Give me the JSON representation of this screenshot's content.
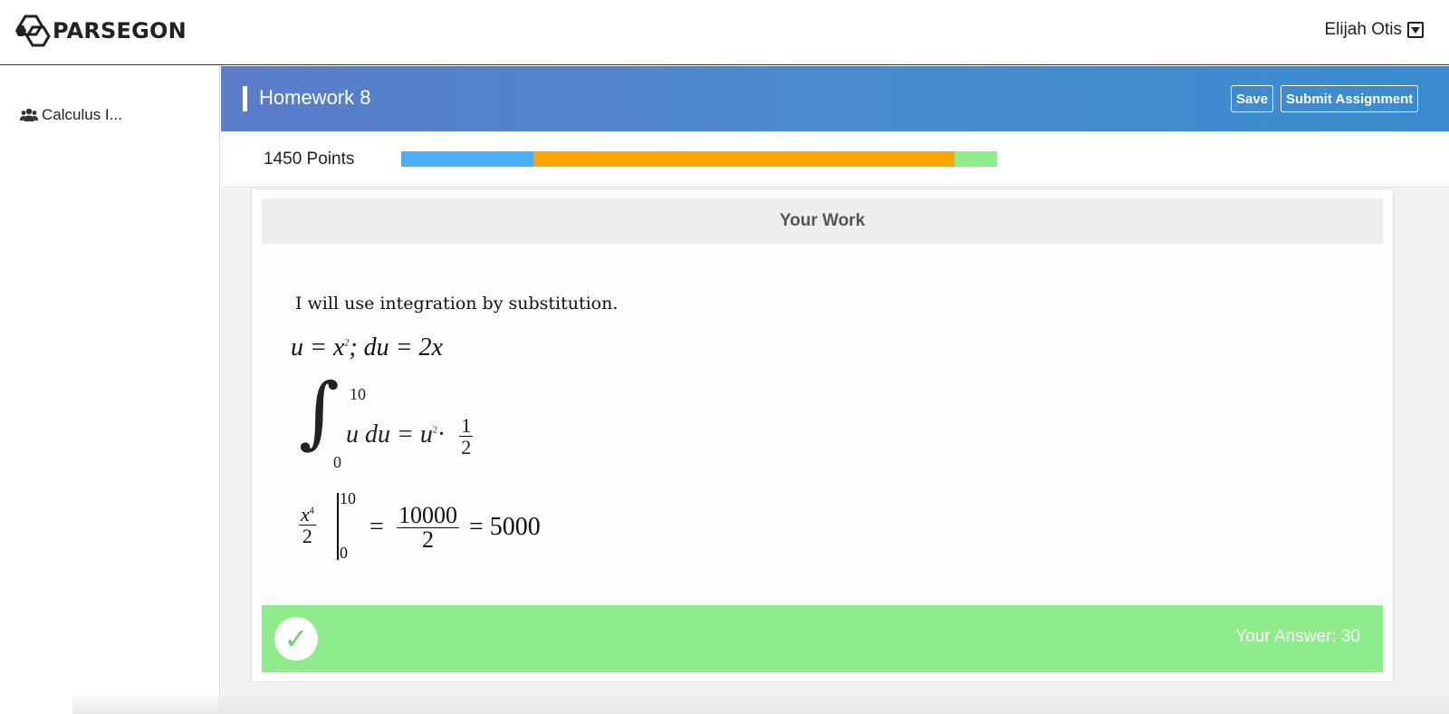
{
  "app": {
    "logo_text": "PARSEGON",
    "user_name": "Elijah Otis"
  },
  "sidebar": {
    "items": [
      {
        "label": "Calculus I...",
        "icon": "users-icon"
      }
    ]
  },
  "assignment": {
    "title": "Homework 8",
    "save_label": "Save",
    "submit_label": "Submit Assignment",
    "points_label": "1450 Points",
    "progress": {
      "segments": [
        {
          "name": "blue",
          "fraction": 0.222,
          "color": "#4ab0fb"
        },
        {
          "name": "orange",
          "fraction": 0.707,
          "color": "#fca500"
        },
        {
          "name": "green",
          "fraction": 0.071,
          "color": "#8eec8a"
        }
      ]
    }
  },
  "work": {
    "header": "Your Work",
    "intro_text": "I will use integration by substitution.",
    "line1_a": "u = x",
    "line1_sup": "2",
    "line1_b": "; du = 2x",
    "integral_upper": "10",
    "integral_lower": "0",
    "integral_body_a": "u du = u",
    "integral_body_sup": "2",
    "integral_body_dot": "·",
    "integral_frac_num": "1",
    "integral_frac_den": "2",
    "eval_num_a": "x",
    "eval_num_sup": "4",
    "eval_den": "2",
    "eval_upper": "10",
    "eval_lower": "0",
    "eval_eq1": "=",
    "eval_frac_num": "10000",
    "eval_frac_den": "2",
    "eval_eq2": "= 5000"
  },
  "answer": {
    "check_glyph": "✓",
    "text": "Your Answer: 30",
    "bar_color": "#8eec8a"
  }
}
